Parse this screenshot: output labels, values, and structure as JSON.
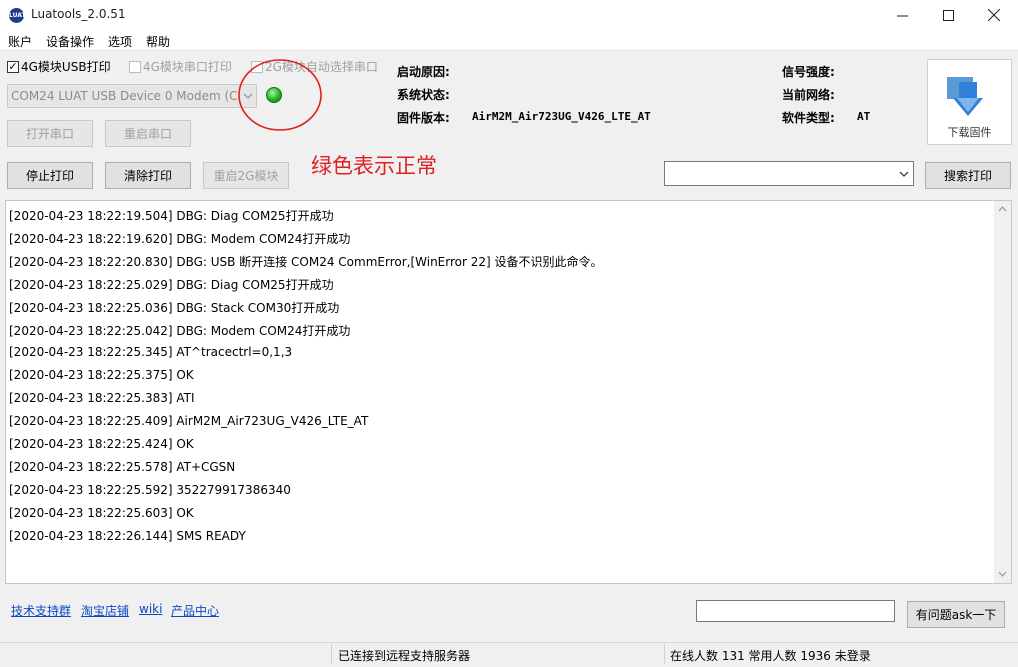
{
  "window": {
    "title": "Luatools_2.0.51",
    "icon_text": "LUAT"
  },
  "menu": [
    "账户",
    "设备操作",
    "选项",
    "帮助"
  ],
  "options": {
    "usb_print": {
      "label": "4G模块USB打印",
      "checked": true
    },
    "uart_print": {
      "label": "4G模块串口打印",
      "checked": false
    },
    "auto_port": {
      "label": "2G模块自动选择串口",
      "checked": false
    }
  },
  "port_select": {
    "value": "COM24 LUAT USB Device 0 Modem (C"
  },
  "status_led": {
    "color": "#22b322",
    "state": "normal"
  },
  "annotation": {
    "text": "绿色表示正常",
    "color": "#e02020"
  },
  "buttons": {
    "open_port": "打开串口",
    "restart_port": "重启串口",
    "stop_print": "停止打印",
    "clear_print": "清除打印",
    "restart_2g": "重启2G模块",
    "search_print": "搜索打印",
    "download_firmware": "下载固件",
    "ask": "有问题ask一下"
  },
  "info": {
    "boot_reason_label": "启动原因:",
    "boot_reason": "",
    "system_state_label": "系统状态:",
    "system_state": "",
    "firmware_label": "固件版本:",
    "firmware": "AirM2M_Air723UG_V426_LTE_AT",
    "signal_label": "信号强度:",
    "signal": "",
    "network_label": "当前网络:",
    "network": "",
    "software_type_label": "软件类型:",
    "software_type": "AT"
  },
  "log_lines": [
    "[2020-04-23 18:22:19.504] DBG: Diag COM25打开成功",
    "[2020-04-23 18:22:19.620] DBG: Modem COM24打开成功",
    "[2020-04-23 18:22:20.830] DBG: USB 断开连接 COM24 CommError,[WinError 22] 设备不识别此命令。",
    "[2020-04-23 18:22:25.029] DBG: Diag COM25打开成功",
    "[2020-04-23 18:22:25.036] DBG: Stack COM30打开成功",
    "[2020-04-23 18:22:25.042] DBG: Modem COM24打开成功",
    "[2020-04-23 18:22:25.345] AT^tracectrl=0,1,3",
    "[2020-04-23 18:22:25.375] OK",
    "[2020-04-23 18:22:25.383] ATI",
    "[2020-04-23 18:22:25.409] AirM2M_Air723UG_V426_LTE_AT",
    "[2020-04-23 18:22:25.424] OK",
    "[2020-04-23 18:22:25.578] AT+CGSN",
    "[2020-04-23 18:22:25.592] 352279917386340",
    "[2020-04-23 18:22:25.603] OK",
    "[2020-04-23 18:22:26.144] SMS READY"
  ],
  "links": [
    "技术支持群",
    "淘宝店铺",
    "wiki",
    "产品中心"
  ],
  "status": {
    "server": "已连接到远程支持服务器",
    "users": "在线人数 131 常用人数 1936 未登录"
  }
}
